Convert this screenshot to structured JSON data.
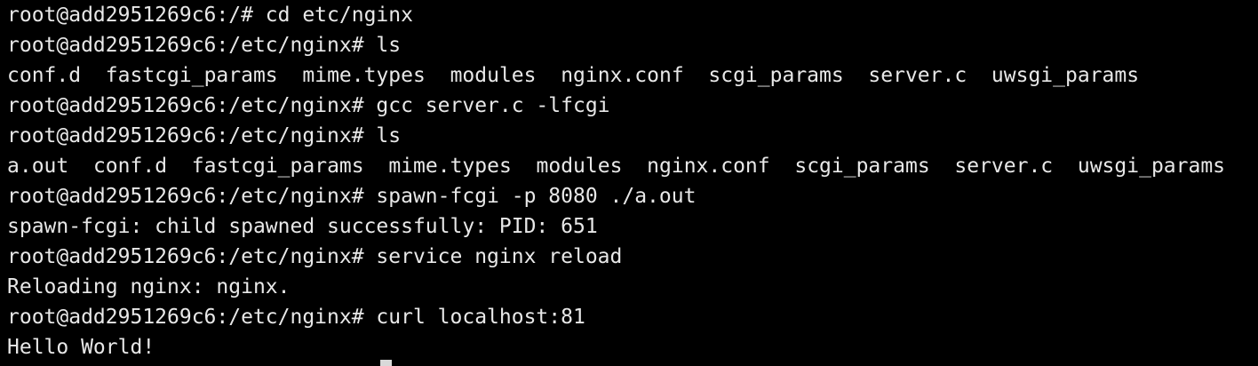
{
  "terminal": {
    "lines": [
      {
        "kind": "prompt",
        "prompt": "root@add2951269c6:/# ",
        "command": "cd etc/nginx"
      },
      {
        "kind": "prompt",
        "prompt": "root@add2951269c6:/etc/nginx# ",
        "command": "ls"
      },
      {
        "kind": "ls",
        "items": [
          "conf.d",
          "fastcgi_params",
          "mime.types",
          "modules",
          "nginx.conf",
          "scgi_params",
          "server.c",
          "uwsgi_params"
        ]
      },
      {
        "kind": "prompt",
        "prompt": "root@add2951269c6:/etc/nginx# ",
        "command": "gcc server.c -lfcgi"
      },
      {
        "kind": "prompt",
        "prompt": "root@add2951269c6:/etc/nginx# ",
        "command": "ls"
      },
      {
        "kind": "ls",
        "items": [
          "a.out",
          "conf.d",
          "fastcgi_params",
          "mime.types",
          "modules",
          "nginx.conf",
          "scgi_params",
          "server.c",
          "uwsgi_params"
        ]
      },
      {
        "kind": "prompt",
        "prompt": "root@add2951269c6:/etc/nginx# ",
        "command": "spawn-fcgi -p 8080 ./a.out"
      },
      {
        "kind": "output",
        "text": "spawn-fcgi: child spawned successfully: PID: 651"
      },
      {
        "kind": "prompt",
        "prompt": "root@add2951269c6:/etc/nginx# ",
        "command": "service nginx reload"
      },
      {
        "kind": "output",
        "text": "Reloading nginx: nginx."
      },
      {
        "kind": "prompt",
        "prompt": "root@add2951269c6:/etc/nginx# ",
        "command": "curl localhost:81"
      },
      {
        "kind": "output",
        "text": "Hello World!"
      }
    ]
  },
  "colors": {
    "background": "#000000",
    "foreground": "#e8e8e8",
    "cursor": "#d9d9d9"
  }
}
